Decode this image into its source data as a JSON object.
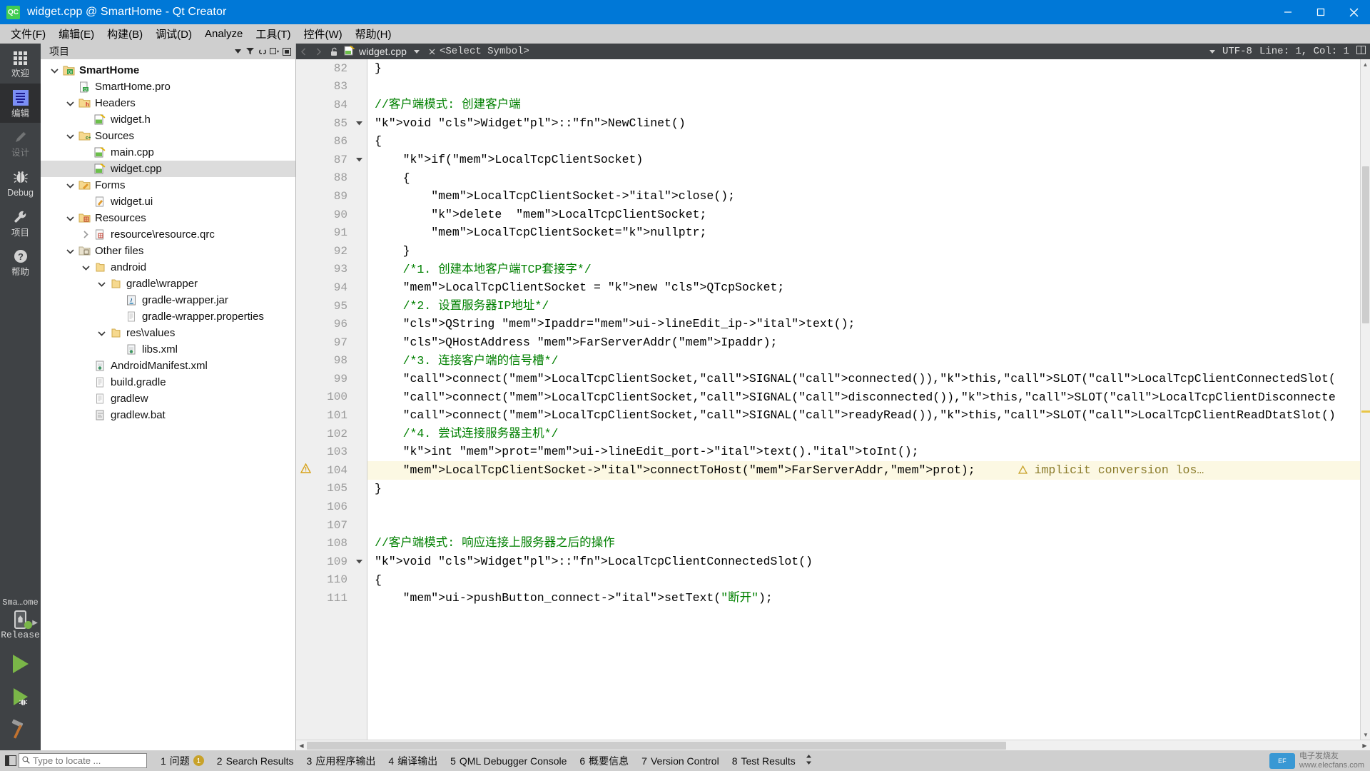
{
  "window": {
    "title": "widget.cpp @ SmartHome - Qt Creator",
    "logo_text": "QC",
    "minimize": "minimize-icon",
    "maximize": "maximize-icon",
    "close": "close-icon"
  },
  "menubar": {
    "items": [
      {
        "label": "文件(F)"
      },
      {
        "label": "编辑(E)"
      },
      {
        "label": "构建(B)"
      },
      {
        "label": "调试(D)"
      },
      {
        "label": "Analyze"
      },
      {
        "label": "工具(T)"
      },
      {
        "label": "控件(W)"
      },
      {
        "label": "帮助(H)"
      }
    ]
  },
  "modebar": {
    "modes": [
      {
        "label": "欢迎",
        "icon": "grid-icon",
        "active": false,
        "disabled": false
      },
      {
        "label": "编辑",
        "icon": "edit-lines-icon",
        "active": true,
        "disabled": false
      },
      {
        "label": "设计",
        "icon": "pencil-icon",
        "active": false,
        "disabled": true
      },
      {
        "label": "Debug",
        "icon": "bug-icon",
        "active": false,
        "disabled": false
      },
      {
        "label": "项目",
        "icon": "wrench-icon",
        "active": false,
        "disabled": false
      },
      {
        "label": "帮助",
        "icon": "question-circle-icon",
        "active": false,
        "disabled": false
      }
    ],
    "kit_name": "Sma…ome",
    "kit_config": "Release",
    "run_button": "run-icon",
    "debug_button": "debug-run-icon",
    "build_button": "build-hammer-icon"
  },
  "project_pane": {
    "title": "项目",
    "toolbar": [
      {
        "name": "filter-icon"
      },
      {
        "name": "link-sync-icon"
      },
      {
        "name": "split-icon"
      },
      {
        "name": "close-pane-icon"
      }
    ],
    "tree": [
      {
        "depth": 0,
        "twisty": "down",
        "icon": "qt-project-icon",
        "label": "SmartHome",
        "bold": true,
        "selected": false
      },
      {
        "depth": 1,
        "twisty": "none",
        "icon": "pro-file-icon",
        "label": "SmartHome.pro",
        "bold": false,
        "selected": false
      },
      {
        "depth": 1,
        "twisty": "down",
        "icon": "folder-h-icon",
        "label": "Headers",
        "bold": false,
        "selected": false
      },
      {
        "depth": 2,
        "twisty": "none",
        "icon": "source-file-icon",
        "label": "widget.h",
        "bold": false,
        "selected": false
      },
      {
        "depth": 1,
        "twisty": "down",
        "icon": "folder-cpp-icon",
        "label": "Sources",
        "bold": false,
        "selected": false
      },
      {
        "depth": 2,
        "twisty": "none",
        "icon": "source-file-icon",
        "label": "main.cpp",
        "bold": false,
        "selected": false
      },
      {
        "depth": 2,
        "twisty": "none",
        "icon": "source-file-icon",
        "label": "widget.cpp",
        "bold": false,
        "selected": true
      },
      {
        "depth": 1,
        "twisty": "down",
        "icon": "folder-forms-icon",
        "label": "Forms",
        "bold": false,
        "selected": false
      },
      {
        "depth": 2,
        "twisty": "none",
        "icon": "ui-file-icon",
        "label": "widget.ui",
        "bold": false,
        "selected": false
      },
      {
        "depth": 1,
        "twisty": "down",
        "icon": "folder-res-icon",
        "label": "Resources",
        "bold": false,
        "selected": false
      },
      {
        "depth": 2,
        "twisty": "right",
        "icon": "qrc-file-icon",
        "label": "resource\\resource.qrc",
        "bold": false,
        "selected": false
      },
      {
        "depth": 1,
        "twisty": "down",
        "icon": "folder-other-icon",
        "label": "Other files",
        "bold": false,
        "selected": false
      },
      {
        "depth": 2,
        "twisty": "down",
        "icon": "folder-icon",
        "label": "android",
        "bold": false,
        "selected": false
      },
      {
        "depth": 3,
        "twisty": "down",
        "icon": "folder-icon",
        "label": "gradle\\wrapper",
        "bold": false,
        "selected": false
      },
      {
        "depth": 4,
        "twisty": "none",
        "icon": "jar-file-icon",
        "label": "gradle-wrapper.jar",
        "bold": false,
        "selected": false
      },
      {
        "depth": 4,
        "twisty": "none",
        "icon": "text-file-icon",
        "label": "gradle-wrapper.properties",
        "bold": false,
        "selected": false
      },
      {
        "depth": 3,
        "twisty": "down",
        "icon": "folder-icon",
        "label": "res\\values",
        "bold": false,
        "selected": false
      },
      {
        "depth": 4,
        "twisty": "none",
        "icon": "xml-file-icon",
        "label": "libs.xml",
        "bold": false,
        "selected": false
      },
      {
        "depth": 2,
        "twisty": "none",
        "icon": "xml-file-icon",
        "label": "AndroidManifest.xml",
        "bold": false,
        "selected": false
      },
      {
        "depth": 2,
        "twisty": "none",
        "icon": "text-file-icon",
        "label": "build.gradle",
        "bold": false,
        "selected": false
      },
      {
        "depth": 2,
        "twisty": "none",
        "icon": "text-file-icon",
        "label": "gradlew",
        "bold": false,
        "selected": false
      },
      {
        "depth": 2,
        "twisty": "none",
        "icon": "bat-file-icon",
        "label": "gradlew.bat",
        "bold": false,
        "selected": false
      }
    ]
  },
  "editor": {
    "toolbar": {
      "back": "back-arrow-icon",
      "forward": "forward-arrow-icon",
      "lock": "unlock-icon",
      "file_name": "widget.cpp",
      "file_icon": "source-file-icon",
      "close_doc": "close-document-icon",
      "symbol_placeholder": "<Select Symbol>",
      "encoding": "UTF-8",
      "position": "Line: 1, Col: 1",
      "split_icon": "split-editor-icon"
    },
    "first_line": 82,
    "lines": [
      {
        "n": 82,
        "fold": "",
        "mark": "",
        "warn": false
      },
      {
        "n": 83,
        "fold": "",
        "mark": "",
        "warn": false
      },
      {
        "n": 84,
        "fold": "",
        "mark": "",
        "warn": false
      },
      {
        "n": 85,
        "fold": "down",
        "mark": "",
        "warn": false
      },
      {
        "n": 86,
        "fold": "",
        "mark": "",
        "warn": false
      },
      {
        "n": 87,
        "fold": "down",
        "mark": "",
        "warn": false
      },
      {
        "n": 88,
        "fold": "",
        "mark": "",
        "warn": false
      },
      {
        "n": 89,
        "fold": "",
        "mark": "",
        "warn": false
      },
      {
        "n": 90,
        "fold": "",
        "mark": "",
        "warn": false
      },
      {
        "n": 91,
        "fold": "",
        "mark": "",
        "warn": false
      },
      {
        "n": 92,
        "fold": "",
        "mark": "",
        "warn": false
      },
      {
        "n": 93,
        "fold": "",
        "mark": "",
        "warn": false
      },
      {
        "n": 94,
        "fold": "",
        "mark": "",
        "warn": false
      },
      {
        "n": 95,
        "fold": "",
        "mark": "",
        "warn": false
      },
      {
        "n": 96,
        "fold": "",
        "mark": "",
        "warn": false
      },
      {
        "n": 97,
        "fold": "",
        "mark": "",
        "warn": false
      },
      {
        "n": 98,
        "fold": "",
        "mark": "",
        "warn": false
      },
      {
        "n": 99,
        "fold": "",
        "mark": "",
        "warn": false
      },
      {
        "n": 100,
        "fold": "",
        "mark": "",
        "warn": false
      },
      {
        "n": 101,
        "fold": "",
        "mark": "",
        "warn": false
      },
      {
        "n": 102,
        "fold": "",
        "mark": "",
        "warn": false
      },
      {
        "n": 103,
        "fold": "",
        "mark": "",
        "warn": false
      },
      {
        "n": 104,
        "fold": "",
        "mark": "warning",
        "warn": true
      },
      {
        "n": 105,
        "fold": "",
        "mark": "",
        "warn": false
      },
      {
        "n": 106,
        "fold": "",
        "mark": "",
        "warn": false
      },
      {
        "n": 107,
        "fold": "",
        "mark": "",
        "warn": false
      },
      {
        "n": 108,
        "fold": "",
        "mark": "",
        "warn": false
      },
      {
        "n": 109,
        "fold": "down",
        "mark": "",
        "warn": false
      },
      {
        "n": 110,
        "fold": "",
        "mark": "",
        "warn": false
      },
      {
        "n": 111,
        "fold": "",
        "mark": "",
        "warn": false
      }
    ],
    "code_text": [
      "}",
      "",
      "//客户端模式: 创建客户端",
      "void Widget::NewClinet()",
      "{",
      "    if(LocalTcpClientSocket)",
      "    {",
      "        LocalTcpClientSocket->close();",
      "        delete  LocalTcpClientSocket;",
      "        LocalTcpClientSocket=nullptr;",
      "    }",
      "    /*1. 创建本地客户端TCP套接字*/",
      "    LocalTcpClientSocket = new QTcpSocket;",
      "    /*2. 设置服务器IP地址*/",
      "    QString Ipaddr=ui->lineEdit_ip->text();",
      "    QHostAddress FarServerAddr(Ipaddr);",
      "    /*3. 连接客户端的信号槽*/",
      "    connect(LocalTcpClientSocket,SIGNAL(connected()),this,SLOT(LocalTcpClientConnectedSlot(",
      "    connect(LocalTcpClientSocket,SIGNAL(disconnected()),this,SLOT(LocalTcpClientDisconnecte",
      "    connect(LocalTcpClientSocket,SIGNAL(readyRead()),this,SLOT(LocalTcpClientReadDtatSlot()",
      "    /*4. 尝试连接服务器主机*/",
      "    int prot=ui->lineEdit_port->text().toInt();",
      "    LocalTcpClientSocket->connectToHost(FarServerAddr,prot);",
      "}",
      "",
      "",
      "//客户端模式: 响应连接上服务器之后的操作",
      "void Widget::LocalTcpClientConnectedSlot()",
      "{",
      "    ui->pushButton_connect->setText(\"断开\");"
    ],
    "warning_annotation": "implicit conversion los…",
    "warning_icon": "warning-triangle-icon"
  },
  "statusbar": {
    "sidebar_toggle_icon": "sidebar-toggle-icon",
    "locator_placeholder": "Type to locate ...",
    "locator_icon": "search-icon",
    "panes": [
      {
        "num": "1",
        "label": "问题",
        "badge": "1",
        "badge_kind": "warning"
      },
      {
        "num": "2",
        "label": "Search Results",
        "badge": "",
        "badge_kind": ""
      },
      {
        "num": "3",
        "label": "应用程序输出",
        "badge": "",
        "badge_kind": ""
      },
      {
        "num": "4",
        "label": "编译输出",
        "badge": "",
        "badge_kind": ""
      },
      {
        "num": "5",
        "label": "QML Debugger Console",
        "badge": "",
        "badge_kind": ""
      },
      {
        "num": "6",
        "label": "概要信息",
        "badge": "",
        "badge_kind": ""
      },
      {
        "num": "7",
        "label": "Version Control",
        "badge": "",
        "badge_kind": ""
      },
      {
        "num": "8",
        "label": "Test Results",
        "badge": "",
        "badge_kind": ""
      }
    ],
    "watermark_title": "电子发烧友",
    "watermark_url": "www.elecfans.com"
  },
  "colors": {
    "accent": "#0078d7",
    "chrome": "#cfcfcf",
    "dark_panel": "#3f4245",
    "keyword": "#808000",
    "comment": "#008000",
    "member": "#8b1a1a",
    "class_name": "#800080",
    "function": "#0a6e8c",
    "warning_bg": "#fcf8e3",
    "green_run": "#7ab648"
  }
}
